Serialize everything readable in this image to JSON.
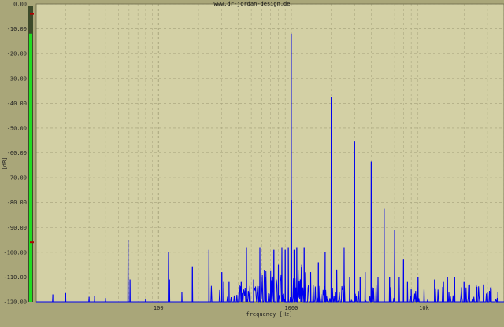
{
  "chart_data": {
    "type": "line",
    "title": "",
    "watermark": "www.dr-jordan-design.de",
    "xlabel": "frequency [Hz]",
    "ylabel": "[dB]",
    "xscale": "log",
    "xlim": [
      12,
      40000
    ],
    "ylim": [
      -120,
      0
    ],
    "y_ticks": [
      {
        "value": 0,
        "label": "0.00"
      },
      {
        "value": -10,
        "label": "-10.00"
      },
      {
        "value": -20,
        "label": "-20.00"
      },
      {
        "value": -30,
        "label": "-30.00"
      },
      {
        "value": -40,
        "label": "-40.00"
      },
      {
        "value": -50,
        "label": "-50.00"
      },
      {
        "value": -60,
        "label": "-60.00"
      },
      {
        "value": -70,
        "label": "-70.00"
      },
      {
        "value": -80,
        "label": "-80.00"
      },
      {
        "value": -90,
        "label": "-90.00"
      },
      {
        "value": -100,
        "label": "-100.00"
      },
      {
        "value": -110,
        "label": "-110.00"
      },
      {
        "value": -120,
        "label": "-120.00"
      }
    ],
    "x_ticks": [
      {
        "value": 100,
        "label": "100"
      },
      {
        "value": 1000,
        "label": "1000"
      },
      {
        "value": 10000,
        "label": "10k"
      }
    ],
    "grid": true,
    "series": [
      {
        "color": "#0000ee",
        "peaks": [
          {
            "x": 16,
            "y": -117
          },
          {
            "x": 20,
            "y": -116.5
          },
          {
            "x": 30,
            "y": -118
          },
          {
            "x": 33,
            "y": -117.5
          },
          {
            "x": 40,
            "y": -118.5
          },
          {
            "x": 59,
            "y": -95
          },
          {
            "x": 61,
            "y": -111
          },
          {
            "x": 80,
            "y": -119
          },
          {
            "x": 119,
            "y": -100
          },
          {
            "x": 121,
            "y": -111
          },
          {
            "x": 150,
            "y": -116
          },
          {
            "x": 180,
            "y": -106
          },
          {
            "x": 240,
            "y": -99
          },
          {
            "x": 300,
            "y": -108
          },
          {
            "x": 310,
            "y": -112
          },
          {
            "x": 340,
            "y": -112
          },
          {
            "x": 420,
            "y": -112
          },
          {
            "x": 460,
            "y": -98
          },
          {
            "x": 520,
            "y": -111
          },
          {
            "x": 580,
            "y": -98
          },
          {
            "x": 640,
            "y": -110
          },
          {
            "x": 700,
            "y": -110
          },
          {
            "x": 740,
            "y": -99
          },
          {
            "x": 800,
            "y": -105
          },
          {
            "x": 850,
            "y": -98
          },
          {
            "x": 900,
            "y": -99
          },
          {
            "x": 950,
            "y": -98
          },
          {
            "x": 995,
            "y": -88
          },
          {
            "x": 1000,
            "y": -12
          },
          {
            "x": 1005,
            "y": -79
          },
          {
            "x": 1050,
            "y": -99
          },
          {
            "x": 1100,
            "y": -98
          },
          {
            "x": 1200,
            "y": -105
          },
          {
            "x": 1250,
            "y": -98
          },
          {
            "x": 1400,
            "y": -108
          },
          {
            "x": 1600,
            "y": -104
          },
          {
            "x": 1800,
            "y": -100
          },
          {
            "x": 2000,
            "y": -37.5
          },
          {
            "x": 2200,
            "y": -107
          },
          {
            "x": 2500,
            "y": -98
          },
          {
            "x": 2750,
            "y": -110
          },
          {
            "x": 3000,
            "y": -55.5
          },
          {
            "x": 3300,
            "y": -110
          },
          {
            "x": 3600,
            "y": -108
          },
          {
            "x": 4000,
            "y": -63.5
          },
          {
            "x": 4500,
            "y": -110
          },
          {
            "x": 5000,
            "y": -82.5
          },
          {
            "x": 5500,
            "y": -110
          },
          {
            "x": 6000,
            "y": -91
          },
          {
            "x": 6500,
            "y": -110
          },
          {
            "x": 7000,
            "y": -103
          },
          {
            "x": 7500,
            "y": -112
          },
          {
            "x": 8000,
            "y": -115
          },
          {
            "x": 9000,
            "y": -110
          },
          {
            "x": 10000,
            "y": -115
          },
          {
            "x": 12000,
            "y": -111
          },
          {
            "x": 14000,
            "y": -112
          },
          {
            "x": 15000,
            "y": -110
          },
          {
            "x": 17000,
            "y": -110
          },
          {
            "x": 20000,
            "y": -112
          },
          {
            "x": 22000,
            "y": -113
          },
          {
            "x": 25000,
            "y": -114
          },
          {
            "x": 28000,
            "y": -113
          },
          {
            "x": 32000,
            "y": -115
          },
          {
            "x": 36000,
            "y": -116
          }
        ]
      }
    ],
    "level_meter": {
      "fill": 0.91,
      "color": "#22dd22",
      "marker_color": "#b00000",
      "marker_values": [
        -4,
        -96
      ]
    }
  }
}
